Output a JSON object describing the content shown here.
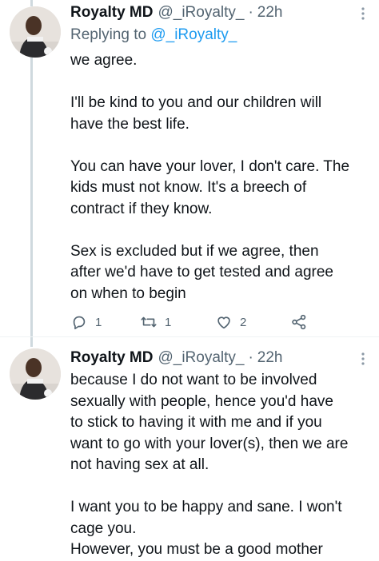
{
  "tweets": [
    {
      "name": "Royalty MD",
      "handle": "@_iRoyalty_",
      "separator": "·",
      "time": "22h",
      "replying_prefix": "Replying to ",
      "replying_to": "@_iRoyalty_",
      "text": "we agree.\n\nI'll be kind to you and our children will\nhave the best life.\n\nYou can have your lover, I don't care. The\nkids must not know. It's a breech of\ncontract if they know.\n\nSex is excluded but if we agree, then\nafter we'd have to get tested and agree\non when to begin",
      "actions": {
        "replies": "1",
        "retweets": "1",
        "likes": "2"
      }
    },
    {
      "name": "Royalty MD",
      "handle": "@_iRoyalty_",
      "separator": "·",
      "time": "22h",
      "text": "because I do not want to be involved\nsexually with people, hence you'd have\nto stick to having it with me and if you\nwant to go with your lover(s), then we are\nnot having sex at all.\n\nI want you to be happy and sane. I won't\ncage you.\nHowever, you must be a good mother"
    }
  ],
  "icons": {
    "more": "more-vertical-icon",
    "reply": "reply-icon",
    "retweet": "retweet-icon",
    "like": "heart-icon",
    "share": "share-icon"
  },
  "colors": {
    "text": "#0f1419",
    "secondary": "#536471",
    "link": "#1d9bf0",
    "thread": "#cfd9de"
  }
}
